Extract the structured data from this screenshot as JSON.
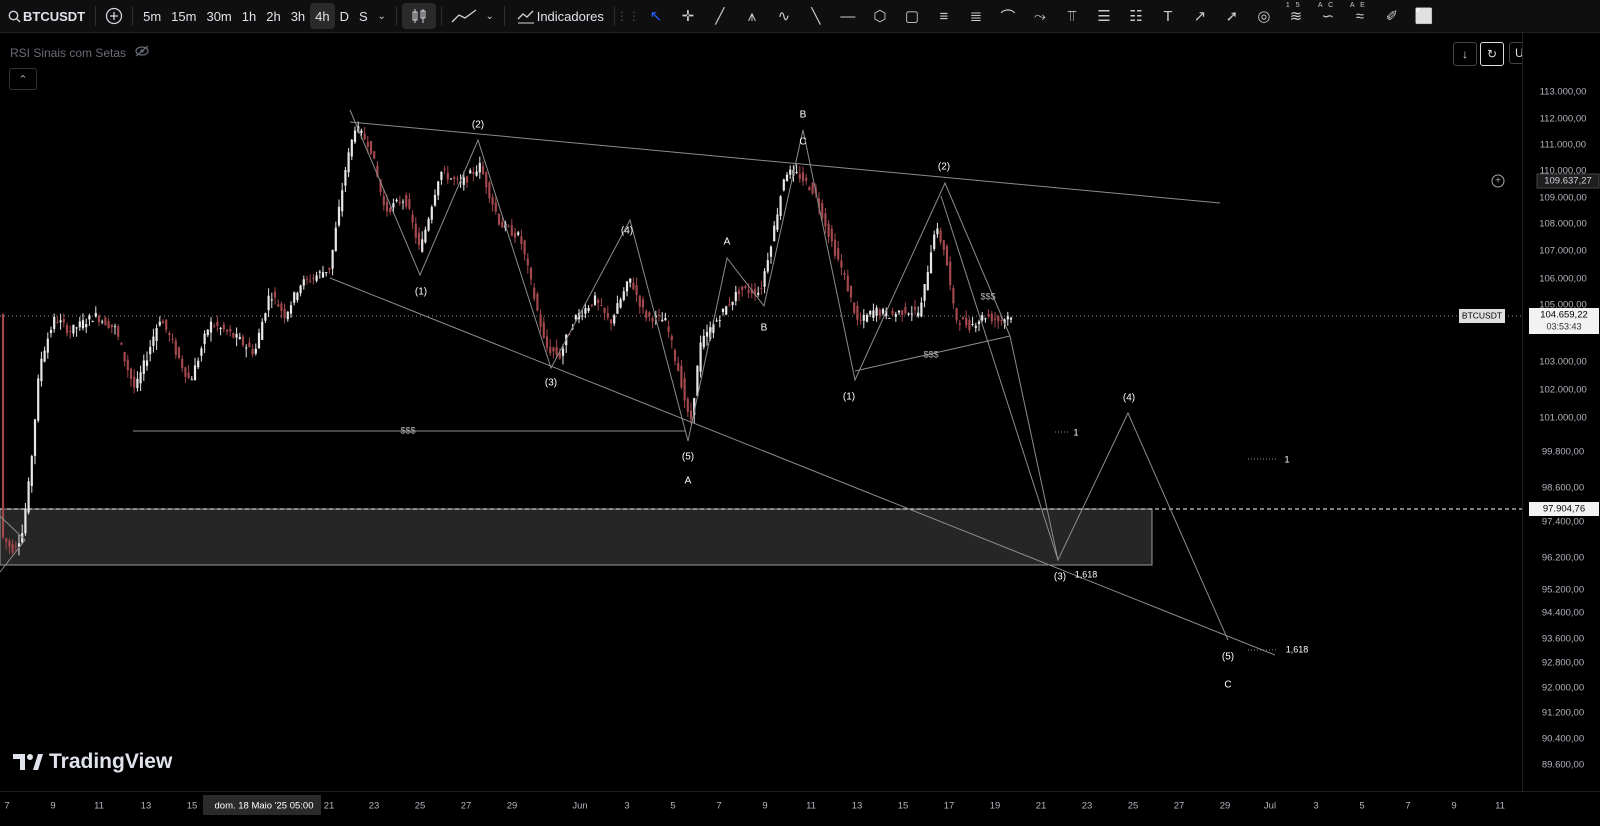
{
  "toolbar": {
    "symbol": "BTCUSDT",
    "timeframes": [
      "5m",
      "15m",
      "30m",
      "1h",
      "2h",
      "3h",
      "4h",
      "D",
      "S"
    ],
    "active_timeframe": "4h",
    "indicators_label": "Indicadores",
    "draw_icons": [
      "cursor-icon",
      "crosshair-icon",
      "trendline-icon",
      "pitchfork-icon",
      "brush-icon",
      "line-icon",
      "horizontal-line-icon",
      "pattern-icon",
      "rectangle-icon",
      "fib-retracement-icon",
      "fib-channel-icon",
      "curve-icon",
      "path-icon",
      "long-position-icon",
      "ruler-icon",
      "measure-icon",
      "text-icon",
      "arrow-icon",
      "arrow-marker-icon",
      "eye-icon",
      "elliott-impulse-icon",
      "elliott-correction-icon",
      "elliott-abcde-icon",
      "paint-icon",
      "square-icon"
    ],
    "elliott_labels": [
      "1 5",
      "A C",
      "A E"
    ]
  },
  "chart": {
    "indicator_name": "RSI Sinais com Setas",
    "currency": "USDT",
    "watermark": "TradingView",
    "accent": "#2962ff",
    "up_color": "#e8e8ea",
    "down_color": "#a3484d",
    "price_axis": {
      "ticks": [
        "113.000,00",
        "112.000,00",
        "111.000,00",
        "110.000,00",
        "109.000,00",
        "108.000,00",
        "107.000,00",
        "106.000,00",
        "105.000,00",
        "103.000,00",
        "102.000,00",
        "101.000,00",
        "99.800,00",
        "98.600,00",
        "97.400,00",
        "96.200,00",
        "95.200,00",
        "94.400,00",
        "93.600,00",
        "92.800,00",
        "92.000,00",
        "91.200,00",
        "90.400,00",
        "89.600,00"
      ],
      "alert_price": "109.637,27",
      "last_symbol": "BTCUSDT",
      "last_price": "104.659,22",
      "countdown": "03:53:43",
      "level_price": "97.904,76"
    },
    "time_axis": {
      "ticks": [
        "7",
        "9",
        "11",
        "13",
        "15",
        "dom. 18 Maio '25   05:00",
        "21",
        "23",
        "25",
        "27",
        "29",
        "Jun",
        "3",
        "5",
        "7",
        "9",
        "11",
        "13",
        "15",
        "17",
        "19",
        "21",
        "23",
        "25",
        "27",
        "29",
        "Jul",
        "3",
        "5",
        "7",
        "9",
        "11"
      ]
    },
    "annotations": {
      "wave_labels": [
        "(2)",
        "(1)",
        "(4)",
        "(3)",
        "(5)",
        "A",
        "A",
        "B",
        "B",
        "C",
        "(2)",
        "(1)",
        "(4)",
        "(3)",
        "(5)",
        "C"
      ],
      "liquidity": [
        "$$$",
        "$$$",
        "$$$"
      ],
      "fib": [
        "1,618",
        "1,618"
      ],
      "ones": [
        "1",
        "1"
      ]
    }
  }
}
